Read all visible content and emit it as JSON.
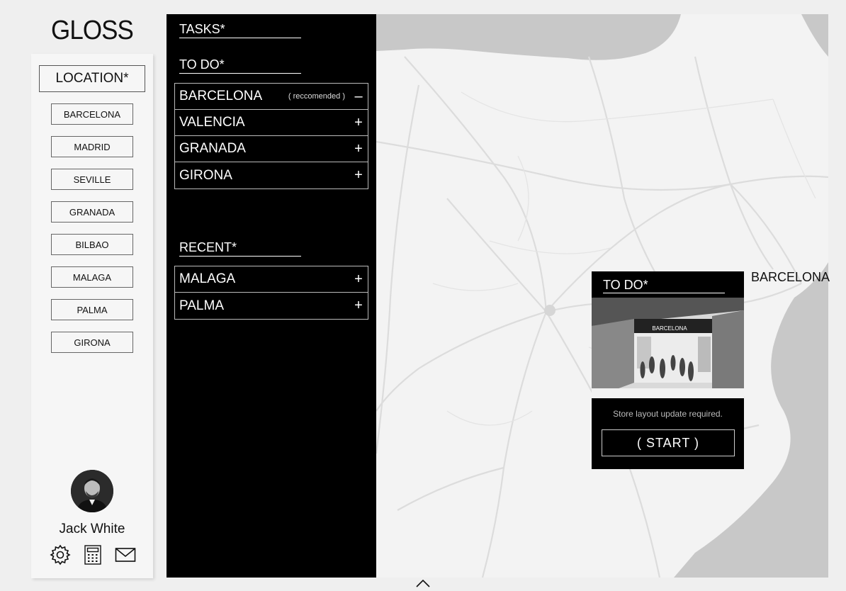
{
  "brand": {
    "logo": "GLOSS"
  },
  "sidebar": {
    "title": "LOCATION*",
    "locations": [
      "BARCELONA",
      "MADRID",
      "SEVILLE",
      "GRANADA",
      "BILBAO",
      "MALAGA",
      "PALMA",
      "GIRONA"
    ],
    "user": {
      "name": "Jack White"
    },
    "icons": [
      "gear-icon",
      "calculator-icon",
      "mail-icon"
    ]
  },
  "tasks": {
    "title": "TASKS*",
    "todo_title": "TO DO*",
    "todo": [
      {
        "name": "BARCELONA",
        "note": "( reccomended )",
        "sign": "–"
      },
      {
        "name": "VALENCIA",
        "note": "",
        "sign": "+"
      },
      {
        "name": "GRANADA",
        "note": "",
        "sign": "+"
      },
      {
        "name": "GIRONA",
        "note": "",
        "sign": "+"
      }
    ],
    "recent_title": "RECENT*",
    "recent": [
      {
        "name": "MALAGA",
        "sign": "+"
      },
      {
        "name": "PALMA",
        "sign": "+"
      }
    ]
  },
  "map_popup": {
    "title": "TO DO*",
    "store_sign": "BARCELONA",
    "description": "Store layout update required.",
    "button": "( START )",
    "city_label": "BARCELONA"
  },
  "colors": {
    "panel": "#000000",
    "background": "#efefef",
    "sea": "#c8c8c8",
    "land": "#f2f2f2"
  }
}
